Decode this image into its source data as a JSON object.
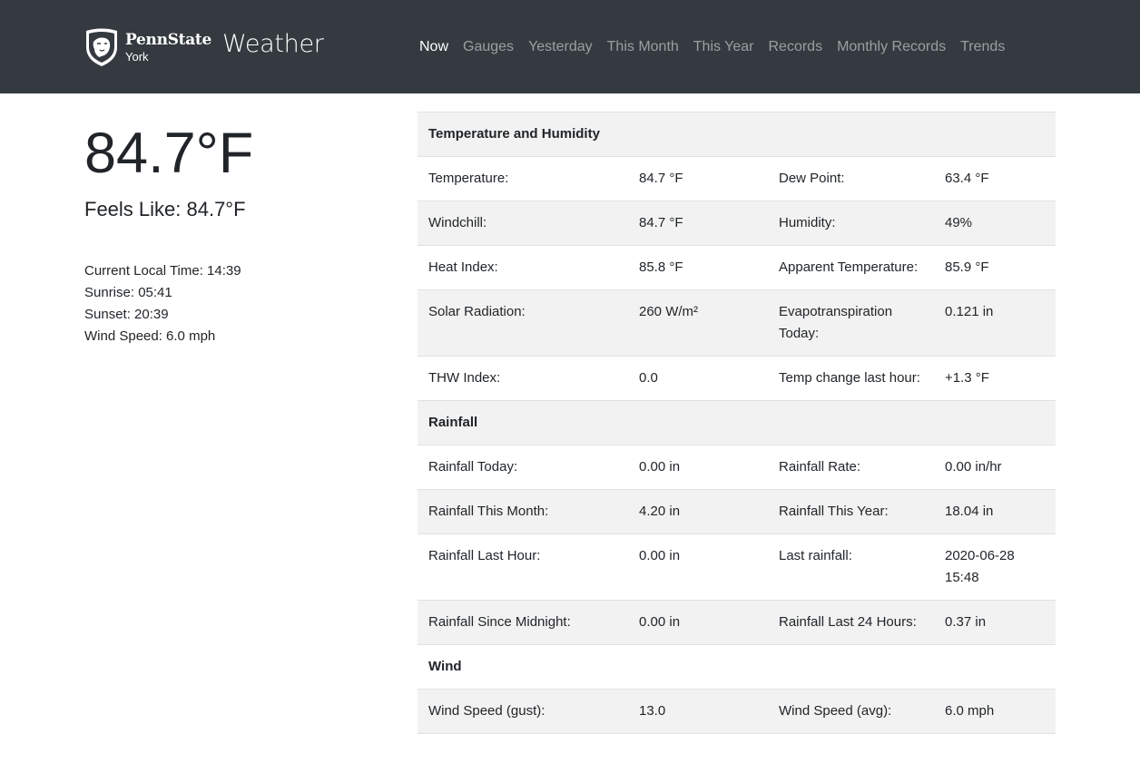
{
  "brand": {
    "name": "PennState",
    "campus": "York",
    "site_title": "Weather"
  },
  "nav": {
    "items": [
      {
        "label": "Now",
        "active": true
      },
      {
        "label": "Gauges"
      },
      {
        "label": "Yesterday"
      },
      {
        "label": "This Month"
      },
      {
        "label": "This Year"
      },
      {
        "label": "Records"
      },
      {
        "label": "Monthly Records"
      },
      {
        "label": "Trends"
      }
    ]
  },
  "current": {
    "temp": "84.7°F",
    "feels_like": "Feels Like: 84.7°F",
    "local_time": "Current Local Time: 14:39",
    "sunrise": "Sunrise: 05:41",
    "sunset": "Sunset: 20:39",
    "wind_speed": "Wind Speed: 6.0 mph"
  },
  "temperature_humidity": {
    "heading": "Temperature and Humidity",
    "rows": [
      {
        "l1": "Temperature:",
        "v1": "84.7 °F",
        "l2": "Dew Point:",
        "v2": "63.4 °F"
      },
      {
        "l1": "Windchill:",
        "v1": "84.7 °F",
        "l2": "Humidity:",
        "v2": "49%"
      },
      {
        "l1": "Heat Index:",
        "v1": "85.8 °F",
        "l2": "Apparent Temperature:",
        "v2": "85.9 °F"
      },
      {
        "l1": "Solar Radiation:",
        "v1": "260 W/m²",
        "l2": "Evapotranspiration Today:",
        "v2": "0.121 in"
      },
      {
        "l1": "THW Index:",
        "v1": "0.0",
        "l2": "Temp change last hour:",
        "v2": "+1.3 °F"
      }
    ]
  },
  "rainfall": {
    "heading": "Rainfall",
    "rows": [
      {
        "l1": "Rainfall Today:",
        "v1": "0.00 in",
        "l2": "Rainfall Rate:",
        "v2": "0.00 in/hr"
      },
      {
        "l1": "Rainfall This Month:",
        "v1": "4.20 in",
        "l2": "Rainfall This Year:",
        "v2": "18.04 in"
      },
      {
        "l1": "Rainfall Last Hour:",
        "v1": "0.00 in",
        "l2": "Last rainfall:",
        "v2": "2020-06-28 15:48"
      },
      {
        "l1": "Rainfall Since Midnight:",
        "v1": "0.00 in",
        "l2": "Rainfall Last 24 Hours:",
        "v2": "0.37 in"
      }
    ]
  },
  "wind": {
    "heading": "Wind",
    "rows": [
      {
        "l1": "Wind Speed (gust):",
        "v1": "13.0",
        "l2": "Wind Speed (avg):",
        "v2": "6.0 mph"
      }
    ]
  },
  "colors": {
    "navbar": "#343a40",
    "stripe": "#f2f2f2",
    "nav_inactive": "rgba(255,255,255,0.5)"
  }
}
